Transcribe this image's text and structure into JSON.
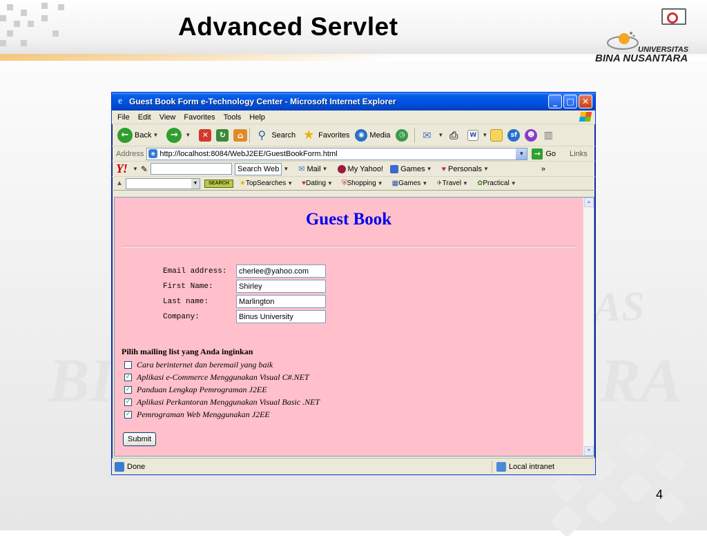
{
  "slide": {
    "title": "Advanced Servlet",
    "page_number": "4",
    "logo_univ": "UNIVERSITAS",
    "logo_name": "BINA NUSANTARA",
    "watermark_left": "BI",
    "watermark_right_top": "AS",
    "watermark_right": "RA"
  },
  "window": {
    "title": "Guest Book Form e-Technology Center - Microsoft Internet Explorer"
  },
  "menu": [
    "File",
    "Edit",
    "View",
    "Favorites",
    "Tools",
    "Help"
  ],
  "toolbar": {
    "back": "Back",
    "search": "Search",
    "favorites": "Favorites",
    "media": "Media"
  },
  "address": {
    "label": "Address",
    "url": "http://localhost:8084/WebJ2EE/GuestBookForm.html",
    "go": "Go",
    "links": "Links"
  },
  "yahoo": {
    "logo": "Y!",
    "search_web": "Search Web",
    "mail": "Mail",
    "my_yahoo": "My Yahoo!",
    "games": "Games",
    "personals": "Personals",
    "more": "»"
  },
  "searchbar": {
    "button": "SEARCH",
    "topsearches": "TopSearches",
    "dating": "Dating",
    "shopping": "Shopping",
    "games": "Games",
    "travel": "Travel",
    "practical": "Practical"
  },
  "page": {
    "heading": "Guest Book",
    "fields": [
      {
        "label": "Email address:",
        "value": "cherlee@yahoo.com"
      },
      {
        "label": "First Name:",
        "value": "Shirley"
      },
      {
        "label": "Last name:",
        "value": "Marlington"
      },
      {
        "label": "Company:",
        "value": "Binus University"
      }
    ],
    "mailing_heading": "Pilih mailing list yang Anda inginkan",
    "mailing": [
      {
        "label": "Cara berinternet dan beremail yang baik",
        "checked": false
      },
      {
        "label": "Aplikasi e-Commerce Menggunakan Visual C#.NET",
        "checked": true
      },
      {
        "label": "Panduan Lengkap Pemrograman J2EE",
        "checked": true
      },
      {
        "label": "Aplikasi Perkantoran Menggunakan Visual Basic .NET",
        "checked": true
      },
      {
        "label": "Pemrograman Web Menggunakan J2EE",
        "checked": true
      }
    ],
    "submit": "Submit"
  },
  "status": {
    "text": "Done",
    "zone": "Local intranet"
  },
  "colors": {
    "page_background": "#ffc0cb",
    "heading": "#0000ee",
    "titlebar": "#0054e3"
  }
}
